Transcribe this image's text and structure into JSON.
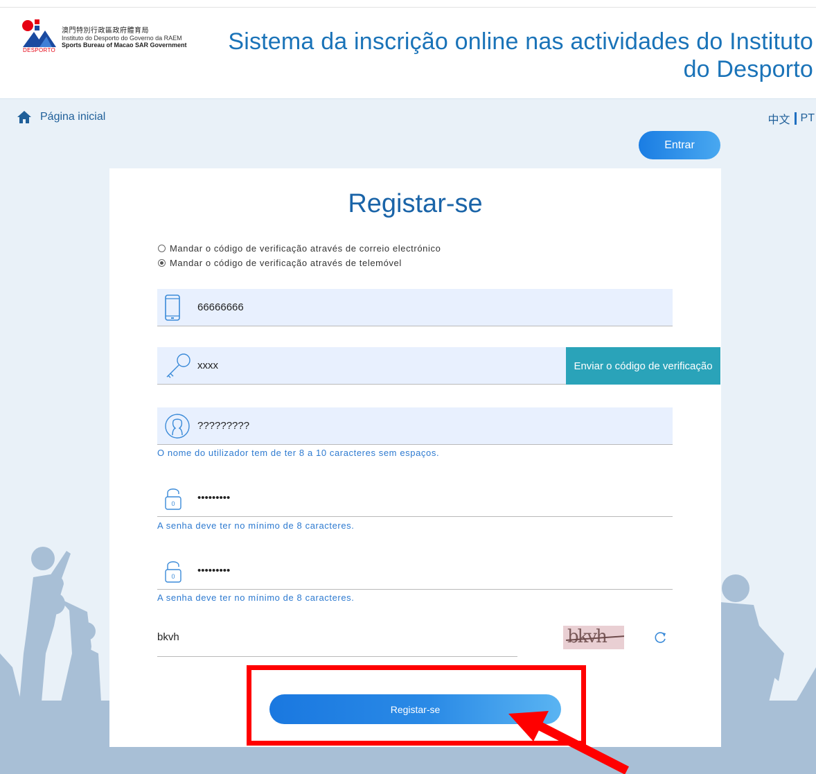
{
  "header": {
    "logo": {
      "chinese_name": "澳門特別行政區政府體育局",
      "portuguese_name": "Instituto do Desporto do Governo da RAEM",
      "english_name": "Sports Bureau of Macao SAR Government",
      "brand_text": "DESPORTO"
    },
    "site_title": "Sistema da inscrição online nas actividades do Instituto do Desporto"
  },
  "nav": {
    "home_label": "Página inicial",
    "home_icon": "home-icon",
    "lang_zh": "中文",
    "lang_pt": "PT",
    "login_label": "Entrar"
  },
  "form": {
    "title": "Registar-se",
    "radio_email": "Mandar o código de verificação através de correio electrónico",
    "radio_mobile": "Mandar o código de verificação através de telemóvel",
    "radio_selected": "mobile",
    "phone_value": "66666666",
    "phone_icon": "mobile-phone-icon",
    "code_value": "xxxx",
    "code_icon": "key-icon",
    "send_code_label": "Enviar o código de verificação",
    "username_value": "?????????",
    "username_icon": "user-icon",
    "username_hint": "O nome do utilizador tem de ter 8 a 10 caracteres sem espaços.",
    "password_value": "•••••••••",
    "password_icon": "padlock-icon",
    "password_hint": "A senha deve ter no mínimo de 8 caracteres.",
    "confirm_password_value": "•••••••••",
    "confirm_password_hint": "A senha deve ter no mínimo de 8 caracteres.",
    "captcha_value": "bkvh",
    "captcha_image_text": "bkvh",
    "refresh_icon": "refresh-icon",
    "submit_label": "Registar-se"
  },
  "colors": {
    "brand_blue": "#1a73b8",
    "button_gradient_start": "#1a7de3",
    "button_gradient_end": "#49a8f0",
    "send_button": "#2aa3b9",
    "hint_blue": "#2d7ad0",
    "annotation_red": "#ff0000"
  }
}
